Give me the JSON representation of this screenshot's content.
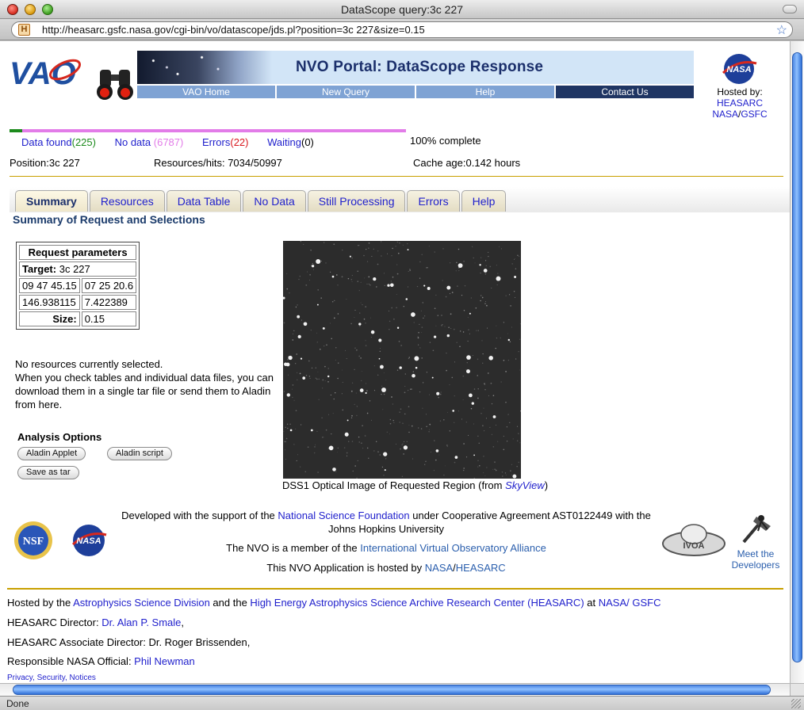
{
  "window": {
    "title": "DataScope query:3c 227",
    "url": "http://heasarc.gsfc.nasa.gov/cgi-bin/vo/datascope/jds.pl?position=3c 227&size=0.15",
    "status": "Done"
  },
  "header": {
    "banner_title": "NVO Portal: DataScope Response",
    "nav": [
      "VAO Home",
      "New Query",
      "Help",
      "Contact Us"
    ],
    "logo_text": "VAO",
    "hosted_label": "Hosted by:",
    "host_heasarc": "HEASARC",
    "host_nasa": "NASA",
    "host_gsfc": "GSFC",
    "nasa_text": "NASA"
  },
  "progress": {
    "found_fraction": 0.032,
    "data_found_label": "Data found",
    "data_found_count": "(225)",
    "no_data_label": "No data",
    "no_data_count": "(6787)",
    "errors_label": "Errors",
    "errors_count": "(22)",
    "waiting_label": "Waiting",
    "waiting_count": "(0)",
    "complete": "100% complete"
  },
  "summary_row": {
    "position": "Position:3c 227",
    "resources": "Resources/hits: 7034/50997",
    "cache": "Cache age:0.142 hours"
  },
  "tabs": [
    "Summary",
    "Resources",
    "Data Table",
    "No Data",
    "Still Processing",
    "Errors",
    "Help"
  ],
  "section_title": "Summary of Request and Selections",
  "params": {
    "header": "Request parameters",
    "target_label": "Target:",
    "target_value": "3c 227",
    "ra_sex": "09 47 45.15",
    "dec_sex": "07 25 20.6",
    "ra_deg": "146.938115",
    "dec_deg": "7.422389",
    "size_label": "Size:",
    "size_value": "0.15"
  },
  "info": {
    "line1": "No resources currently selected.",
    "line2": "When you check tables and individual data files, you can download them in a single tar file or send them to Aladin from here."
  },
  "analysis": {
    "title": "Analysis Options",
    "aladin_applet": "Aladin Applet",
    "aladin_script": "Aladin script",
    "save_tar": "Save as tar"
  },
  "image": {
    "caption_pre": "DSS1 Optical Image of Requested Region (from ",
    "caption_link": "SkyView",
    "caption_post": ")"
  },
  "ack": {
    "l1_pre": "Developed with the support of the ",
    "l1_link": "National Science Foundation",
    "l1_post": " under Cooperative Agreement AST0122449 with the Johns Hopkins University",
    "l2_pre": "The NVO is a member of the ",
    "l2_link": "International Virtual Observatory Alliance",
    "l3_pre": "This NVO Application is hosted by ",
    "l3_link1": "NASA",
    "l3_link2": "HEASARC",
    "nsf_text": "NSF",
    "nasa_text": "NASA",
    "ivoa_text": "IVOA",
    "meet_developers": "Meet the Developers"
  },
  "credits": {
    "hosted_pre": "Hosted by the ",
    "asd": "Astrophysics Science Division",
    "and_the": " and the ",
    "heasarc_full": "High Energy Astrophysics Science Archive Research Center (HEASARC)",
    "at": " at ",
    "nasa_gsfc": "NASA/ GSFC",
    "director_label": "HEASARC Director: ",
    "director_name": "Dr. Alan P. Smale",
    "director_post": ",",
    "assoc": "HEASARC Associate Director: Dr. Roger Brissenden,",
    "official_label": "Responsible NASA Official: ",
    "official_name": "Phil Newman",
    "privacy": "Privacy, Security, Notices"
  }
}
